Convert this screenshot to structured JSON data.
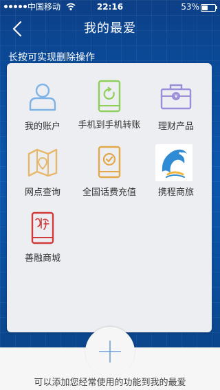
{
  "status_bar": {
    "carrier": "中国移动",
    "time": "22:16",
    "battery": "53%",
    "battery_level": 0.53
  },
  "nav": {
    "title": "我的最爱",
    "back_icon": "chevron-left-icon"
  },
  "hint_top": "长按可实现删除操作",
  "favorites": [
    {
      "label": "我的账户",
      "icon": "user-icon",
      "color": "#7fb3e6"
    },
    {
      "label": "手机到手机转账",
      "icon": "phone-transfer-icon",
      "color": "#8ecf5a"
    },
    {
      "label": "理财产品",
      "icon": "briefcase-yen-icon",
      "color": "#9b8ed8"
    },
    {
      "label": "网点查询",
      "icon": "map-icon",
      "color": "#e7b86a"
    },
    {
      "label": "全国话费充值",
      "icon": "phone-check-icon",
      "color": "#e2a84a"
    },
    {
      "label": "携程商旅",
      "icon": "dolphin-logo-icon",
      "color": "#2f8bd4"
    },
    {
      "label": "善融商城",
      "icon": "shanrong-phone-icon",
      "color": "#d03a3a"
    }
  ],
  "add_button": {
    "icon": "plus-icon"
  },
  "bottom_hint": "可以添加您经常使用的功能到我的最爱",
  "colors": {
    "background": "#0b57ae",
    "panel": "#eceef2",
    "bottom_bar": "#f6f6f6"
  }
}
